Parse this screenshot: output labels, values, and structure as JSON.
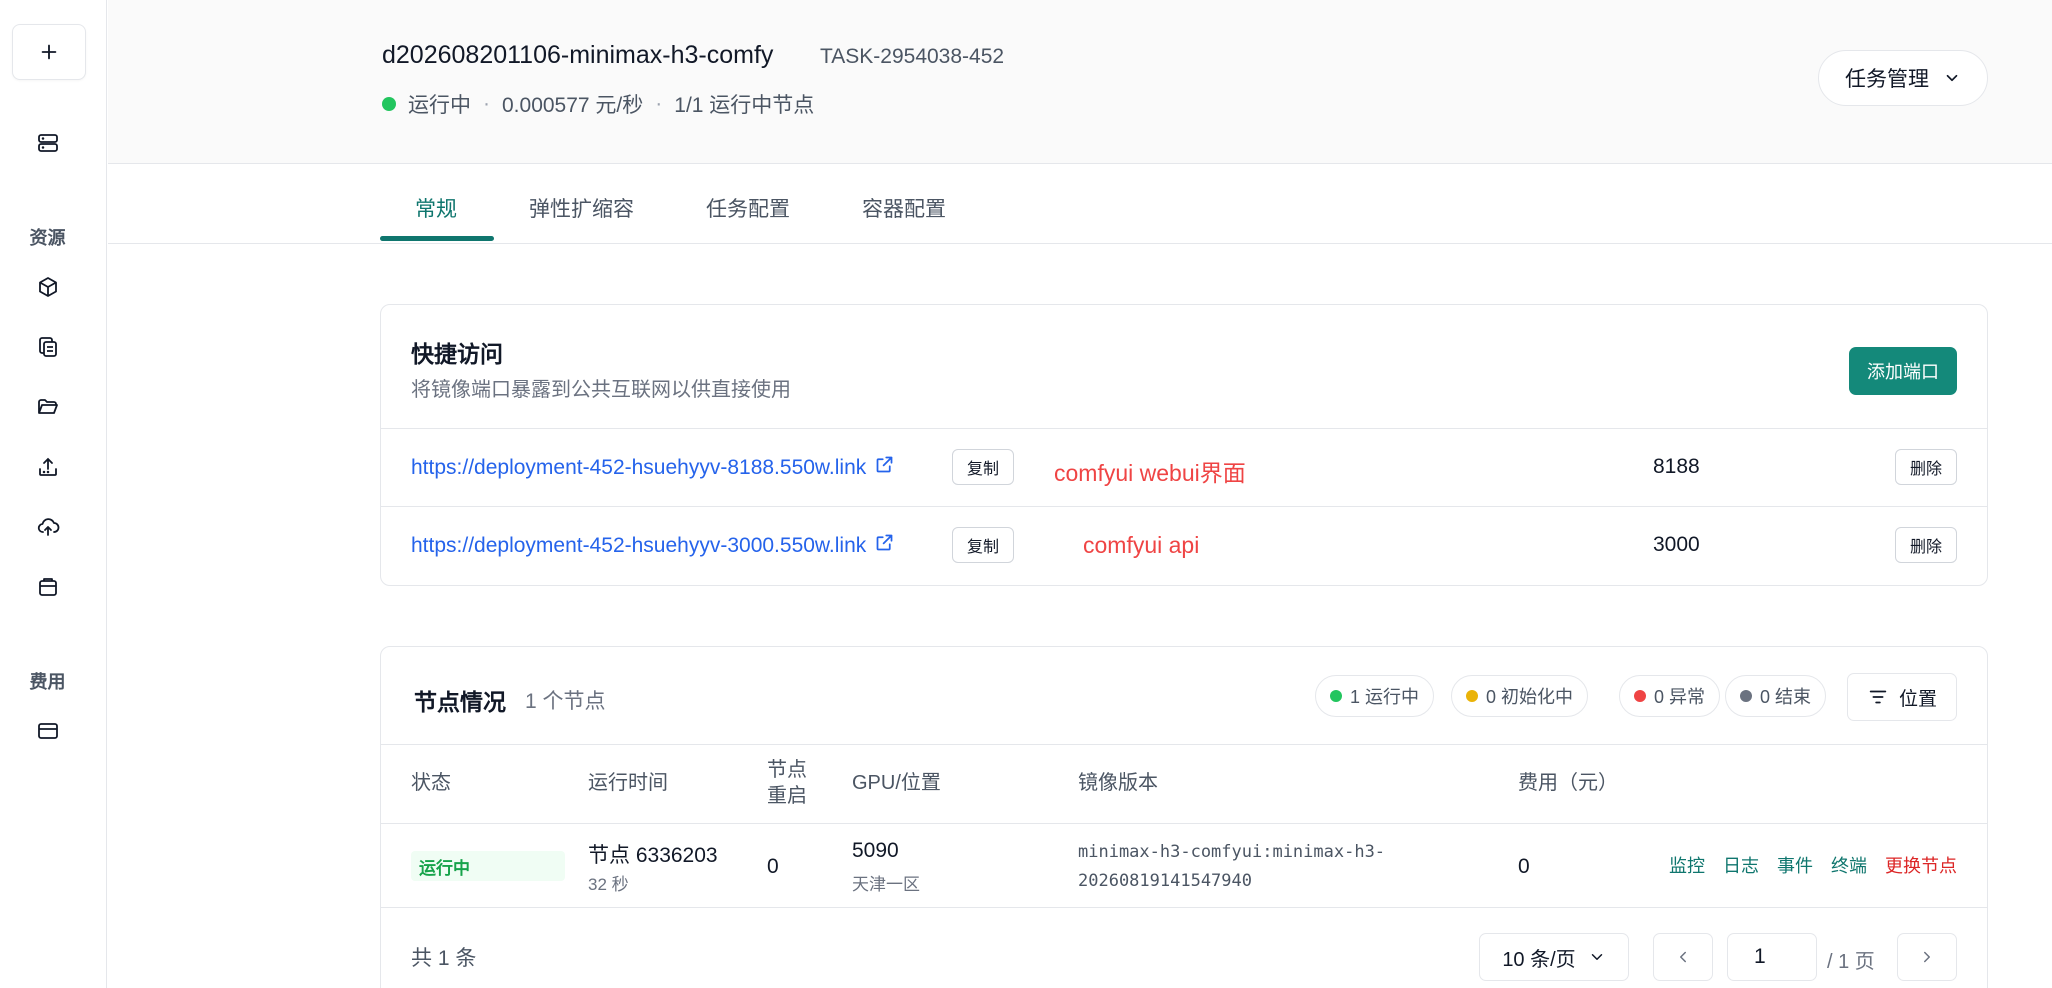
{
  "sidebar": {
    "sections": [
      {
        "label": "资源"
      },
      {
        "label": "费用"
      }
    ]
  },
  "header": {
    "title": "d202608201106-minimax-h3-comfy",
    "task_id": "TASK-2954038-452",
    "status": "运行中",
    "price": "0.000577 元/秒",
    "nodes_running": "1/1 运行中节点",
    "separator": "·",
    "task_mgmt_label": "任务管理"
  },
  "tabs": [
    {
      "label": "常规"
    },
    {
      "label": "弹性扩缩容"
    },
    {
      "label": "任务配置"
    },
    {
      "label": "容器配置"
    }
  ],
  "quick_access": {
    "title": "快捷访问",
    "subtitle": "将镜像端口暴露到公共互联网以供直接使用",
    "add_port_label": "添加端口",
    "rows": [
      {
        "url": "https://deployment-452-hsuehyyv-8188.550w.link",
        "copy_label": "复制",
        "note": "comfyui webui界面",
        "port": "8188",
        "delete_label": "删除"
      },
      {
        "url": "https://deployment-452-hsuehyyv-3000.550w.link",
        "copy_label": "复制",
        "note": "comfyui api",
        "port": "3000",
        "delete_label": "删除"
      }
    ]
  },
  "nodes": {
    "title": "节点情况",
    "count": "1 个节点",
    "pills": [
      {
        "label": "1 运行中",
        "color": "#22c55e"
      },
      {
        "label": "0 初始化中",
        "color": "#eab308"
      },
      {
        "label": "0 异常",
        "color": "#ef4444"
      },
      {
        "label": "0 结束",
        "color": "#6b7280"
      }
    ],
    "location_label": "位置",
    "columns": [
      "状态",
      "运行时间",
      "节点\n重启",
      "GPU/位置",
      "镜像版本",
      "费用（元）"
    ],
    "rows": [
      {
        "status": "运行中",
        "node": "节点 6336203",
        "uptime": "32 秒",
        "restarts": "0",
        "gpu": "5090",
        "location": "天津一区",
        "image_line1": "minimax-h3-comfyui:minimax-h3-",
        "image_line2": "20260819141547940",
        "cost": "0",
        "actions": [
          "监控",
          "日志",
          "事件",
          "终端",
          "更换节点"
        ]
      }
    ],
    "total": "共 1 条",
    "page_size": "10 条/页",
    "page": "1",
    "page_total": "/ 1 页"
  },
  "colors": {
    "accent": "#0f766e",
    "primary_button": "#14897a",
    "link": "#2563eb",
    "annotation": "#ef4444"
  }
}
